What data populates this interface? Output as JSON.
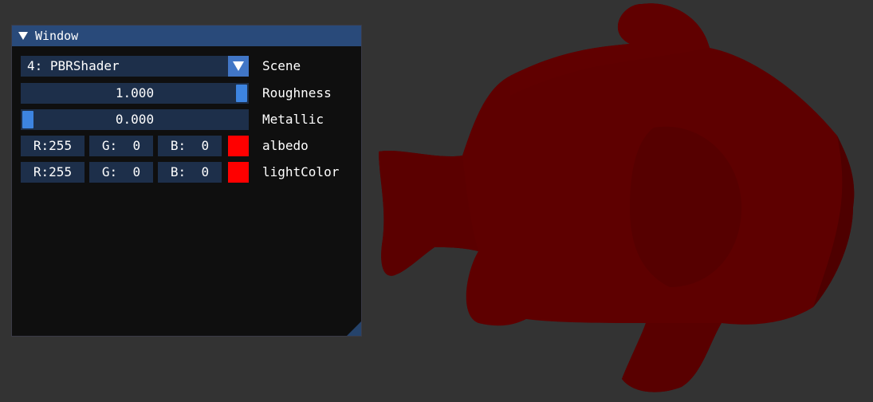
{
  "window": {
    "title": "Window"
  },
  "scene": {
    "value": "4: PBRShader",
    "label": "Scene"
  },
  "roughness": {
    "value_text": "1.000",
    "value": 1.0,
    "label": "Roughness"
  },
  "metallic": {
    "value_text": "0.000",
    "value": 0.0,
    "label": "Metallic"
  },
  "albedo": {
    "r": "R:255",
    "g": "G:  0",
    "b": "B:  0",
    "label": "albedo",
    "color": "#ff0000"
  },
  "lightColor": {
    "r": "R:255",
    "g": "G:  0",
    "b": "B:  0",
    "label": "lightColor",
    "color": "#ff0000"
  },
  "colors": {
    "background": "#333333",
    "fish": "#5e0000",
    "accent": "#3d84e0"
  }
}
